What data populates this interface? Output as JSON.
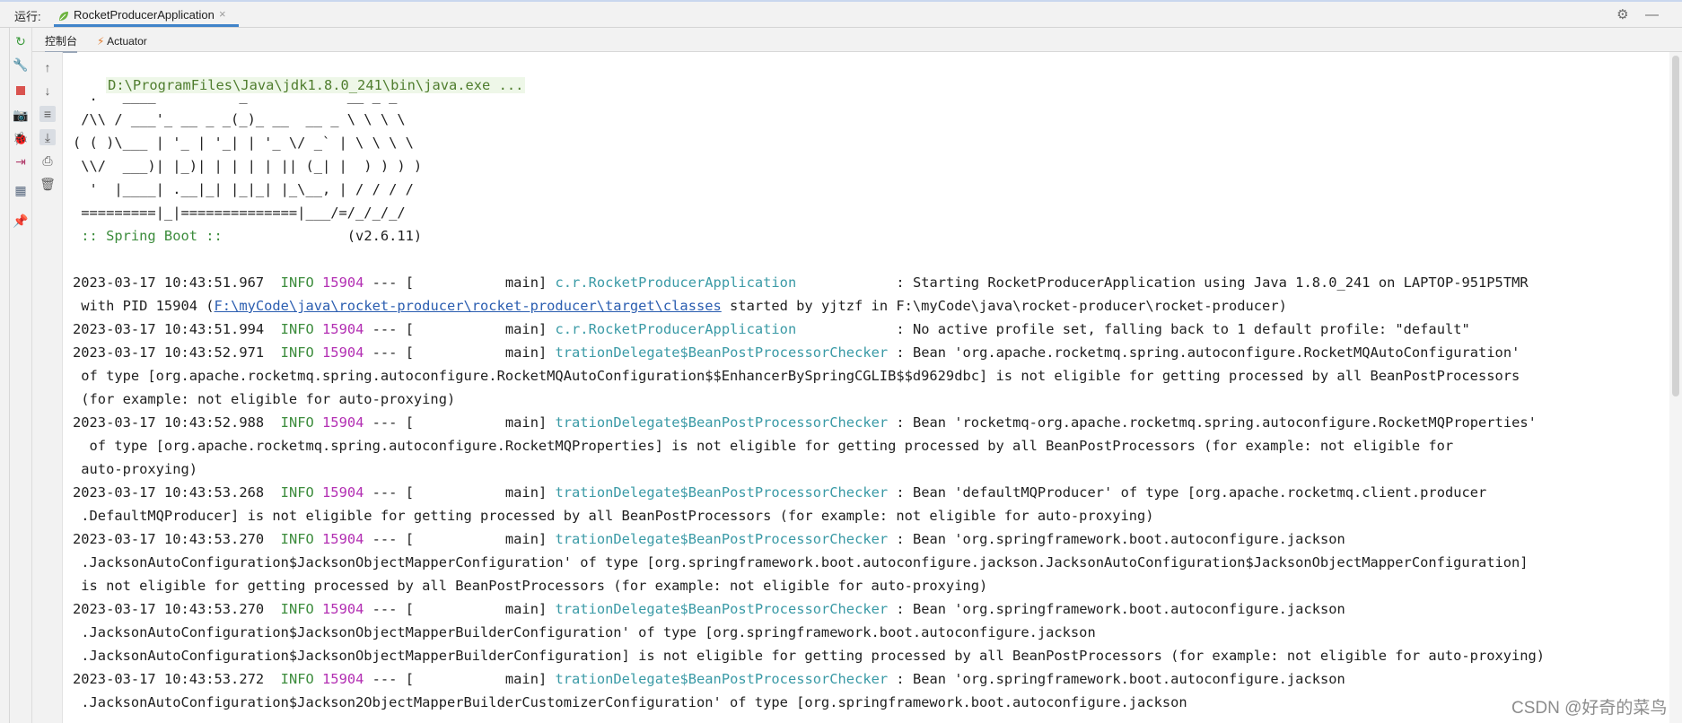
{
  "run_panel": {
    "label": "运行:",
    "tab_name": "RocketProducerApplication",
    "close_glyph": "×",
    "settings_icon": "gear-icon",
    "minimize_icon": "minimize-icon"
  },
  "subtabs": {
    "console": "控制台",
    "actuator": "Actuator"
  },
  "left_toolbar_icons": [
    "rerun-icon",
    "wrench-icon",
    "stop-icon",
    "camera-icon",
    "debug-bug-icon",
    "exit-icon",
    "layout-icon",
    "pin-icon"
  ],
  "console_toolbar_icons": [
    "arrow-up-icon",
    "arrow-down-icon",
    "soft-wrap-icon",
    "scroll-to-end-icon",
    "print-icon",
    "trash-icon"
  ],
  "console": {
    "command": "D:\\ProgramFiles\\Java\\jdk1.8.0_241\\bin\\java.exe ...",
    "banner": [
      "  .   ____          _            __ _ _",
      " /\\\\ / ___'_ __ _ _(_)_ __  __ _ \\ \\ \\ \\",
      "( ( )\\___ | '_ | '_| | '_ \\/ _` | \\ \\ \\ \\",
      " \\\\/  ___)| |_)| | | | | || (_| |  ) ) ) )",
      "  '  |____| .__|_| |_|_| |_\\__, | / / / /",
      " =========|_|==============|___/=/_/_/_/"
    ],
    "spring_label": " :: Spring Boot :: ",
    "spring_version": "              (v2.6.11)",
    "logs": [
      {
        "timestamp": "2023-03-17 10:43:51.967",
        "level": "INFO",
        "pid": "15904",
        "thread": " --- [           main] ",
        "logger": "c.r.RocketProducerApplication           ",
        "message": " : Starting RocketProducerApplication using Java 1.8.0_241 on LAPTOP-951P5TMR",
        "cont": [
          {
            "pre": " with PID 15904 (",
            "link": "F:\\myCode\\java\\rocket-producer\\rocket-producer\\target\\classes",
            "post": " started by yjtzf in F:\\myCode\\java\\rocket-producer\\rocket-producer)"
          }
        ]
      },
      {
        "timestamp": "2023-03-17 10:43:51.994",
        "level": "INFO",
        "pid": "15904",
        "thread": " --- [           main] ",
        "logger": "c.r.RocketProducerApplication           ",
        "message": " : No active profile set, falling back to 1 default profile: \"default\"",
        "cont": []
      },
      {
        "timestamp": "2023-03-17 10:43:52.971",
        "level": "INFO",
        "pid": "15904",
        "thread": " --- [           main] ",
        "logger": "trationDelegate$BeanPostProcessorChecker",
        "message": " : Bean 'org.apache.rocketmq.spring.autoconfigure.RocketMQAutoConfiguration'",
        "cont": [
          {
            "pre": " of type [org.apache.rocketmq.spring.autoconfigure.RocketMQAutoConfiguration$$EnhancerBySpringCGLIB$$d9629dbc] is not eligible for getting processed by all BeanPostProcessors",
            "link": "",
            "post": ""
          },
          {
            "pre": " (for example: not eligible for auto-proxying)",
            "link": "",
            "post": ""
          }
        ]
      },
      {
        "timestamp": "2023-03-17 10:43:52.988",
        "level": "INFO",
        "pid": "15904",
        "thread": " --- [           main] ",
        "logger": "trationDelegate$BeanPostProcessorChecker",
        "message": " : Bean 'rocketmq-org.apache.rocketmq.spring.autoconfigure.RocketMQProperties'",
        "cont": [
          {
            "pre": "  of type [org.apache.rocketmq.spring.autoconfigure.RocketMQProperties] is not eligible for getting processed by all BeanPostProcessors (for example: not eligible for",
            "link": "",
            "post": ""
          },
          {
            "pre": " auto-proxying)",
            "link": "",
            "post": ""
          }
        ]
      },
      {
        "timestamp": "2023-03-17 10:43:53.268",
        "level": "INFO",
        "pid": "15904",
        "thread": " --- [           main] ",
        "logger": "trationDelegate$BeanPostProcessorChecker",
        "message": " : Bean 'defaultMQProducer' of type [org.apache.rocketmq.client.producer",
        "cont": [
          {
            "pre": " .DefaultMQProducer] is not eligible for getting processed by all BeanPostProcessors (for example: not eligible for auto-proxying)",
            "link": "",
            "post": ""
          }
        ]
      },
      {
        "timestamp": "2023-03-17 10:43:53.270",
        "level": "INFO",
        "pid": "15904",
        "thread": " --- [           main] ",
        "logger": "trationDelegate$BeanPostProcessorChecker",
        "message": " : Bean 'org.springframework.boot.autoconfigure.jackson",
        "cont": [
          {
            "pre": " .JacksonAutoConfiguration$JacksonObjectMapperConfiguration' of type [org.springframework.boot.autoconfigure.jackson.JacksonAutoConfiguration$JacksonObjectMapperConfiguration]",
            "link": "",
            "post": ""
          },
          {
            "pre": " is not eligible for getting processed by all BeanPostProcessors (for example: not eligible for auto-proxying)",
            "link": "",
            "post": ""
          }
        ]
      },
      {
        "timestamp": "2023-03-17 10:43:53.270",
        "level": "INFO",
        "pid": "15904",
        "thread": " --- [           main] ",
        "logger": "trationDelegate$BeanPostProcessorChecker",
        "message": " : Bean 'org.springframework.boot.autoconfigure.jackson",
        "cont": [
          {
            "pre": " .JacksonAutoConfiguration$JacksonObjectMapperBuilderConfiguration' of type [org.springframework.boot.autoconfigure.jackson",
            "link": "",
            "post": ""
          },
          {
            "pre": " .JacksonAutoConfiguration$JacksonObjectMapperBuilderConfiguration] is not eligible for getting processed by all BeanPostProcessors (for example: not eligible for auto-proxying)",
            "link": "",
            "post": ""
          }
        ]
      },
      {
        "timestamp": "2023-03-17 10:43:53.272",
        "level": "INFO",
        "pid": "15904",
        "thread": " --- [           main] ",
        "logger": "trationDelegate$BeanPostProcessorChecker",
        "message": " : Bean 'org.springframework.boot.autoconfigure.jackson",
        "cont": [
          {
            "pre": " .JacksonAutoConfiguration$Jackson2ObjectMapperBuilderCustomizerConfiguration' of type [org.springframework.boot.autoconfigure.jackson",
            "link": "",
            "post": ""
          }
        ]
      }
    ]
  },
  "watermark": "CSDN @好奇的菜鸟"
}
